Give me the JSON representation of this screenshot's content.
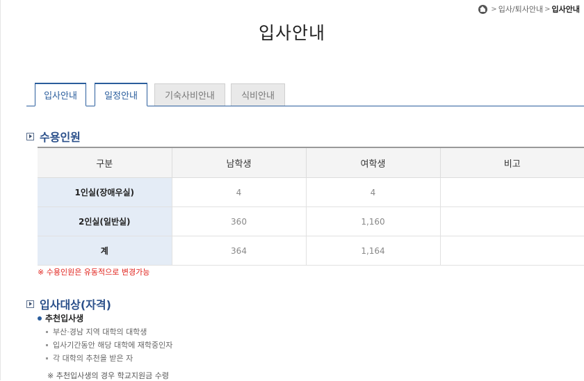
{
  "breadcrumb": {
    "items": [
      "입사/퇴사안내",
      "입사안내"
    ],
    "separator": ">"
  },
  "page_title": "입사안내",
  "tabs": [
    {
      "label": "입사안내",
      "state": "active"
    },
    {
      "label": "일정안내",
      "state": "active"
    },
    {
      "label": "기숙사비안내",
      "state": "inactive"
    },
    {
      "label": "식비안내",
      "state": "inactive"
    }
  ],
  "capacity": {
    "heading": "수용인원",
    "headers": [
      "구분",
      "남학생",
      "여학생",
      "비고"
    ],
    "rows": [
      {
        "label": "1인실(장애우실)",
        "male": "4",
        "female": "4",
        "note": ""
      },
      {
        "label": "2인실(일반실)",
        "male": "360",
        "female": "1,160",
        "note": ""
      },
      {
        "label": "계",
        "male": "364",
        "female": "1,164",
        "note": ""
      }
    ],
    "footnote": "※ 수용인원은 유동적으로 변경가능"
  },
  "eligibility": {
    "heading": "입사대상(자격)",
    "subheading": "추천입사생",
    "items": [
      "부산·경남 지역 대학의 대학생",
      "입사기간동안 해당 대학에 재학중인자",
      "각 대학의 추천을 받은 자"
    ],
    "note": "※ 추천입사생의 경우 학교지원금 수령"
  },
  "colors": {
    "accent": "#2a5d9c",
    "row_header_bg": "#e4ecf6",
    "alert": "#e0201a"
  },
  "icons": {
    "home": "home-icon",
    "section": "box-arrow-icon"
  }
}
